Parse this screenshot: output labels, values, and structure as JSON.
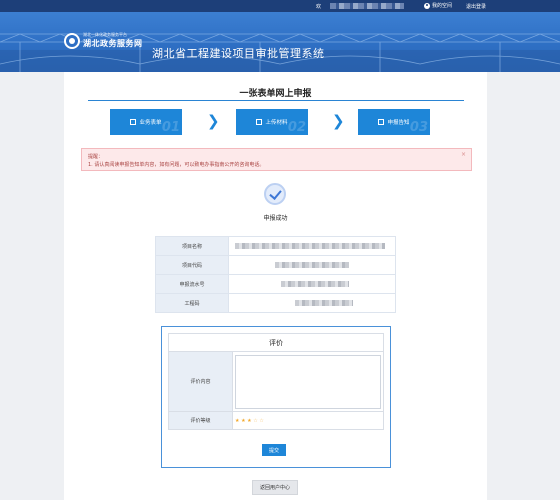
{
  "topbar": {
    "welcome": "欢",
    "my_space": "我的空间",
    "logout": "退出登录"
  },
  "banner": {
    "logo_small": "湖北一体化政务服务平台",
    "logo_big": "湖北政务服务网",
    "system_title": "湖北省工程建设项目审批管理系统"
  },
  "page": {
    "title": "一张表单网上申报"
  },
  "steps": [
    {
      "label": "业务表单",
      "num": "01",
      "icon": "edit-icon"
    },
    {
      "label": "上传材料",
      "num": "02",
      "icon": "folder-icon"
    },
    {
      "label": "申报告知",
      "num": "03",
      "icon": "calendar-icon"
    }
  ],
  "notice": {
    "heading": "提醒：",
    "text": "1. 请认真阅读申报告知单内容，如有问题，可以致电办事指南公开的咨询电话。",
    "close": "×"
  },
  "result": {
    "success_text": "申报成功"
  },
  "info_rows": [
    {
      "label": "项目名称"
    },
    {
      "label": "项目代码"
    },
    {
      "label": "申报流水号"
    },
    {
      "label": "工程码"
    }
  ],
  "evaluation": {
    "title": "评价",
    "content_label": "评价内容",
    "content_value": "",
    "level_label": "评价等级",
    "rating": 3,
    "rating_max": 5,
    "submit_label": "提交"
  },
  "back_button": "返回用户中心",
  "colors": {
    "topbar": "#1d3f79",
    "banner": "#2e6fc4",
    "accent": "#1e86d8",
    "star": "#f2a82a",
    "notice_bg": "#fde9ea"
  }
}
